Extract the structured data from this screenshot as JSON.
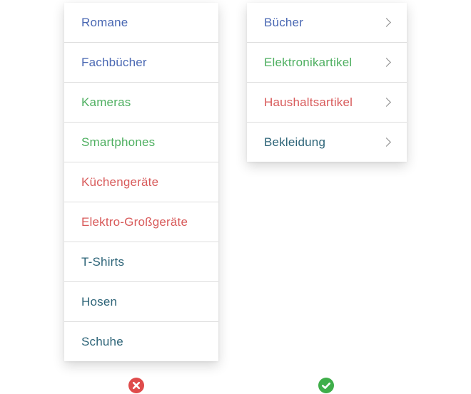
{
  "colors": {
    "books": "#4a68b3",
    "electronics": "#4eaf60",
    "household": "#d85a5a",
    "clothing": "#2d6478",
    "error": "#df4b4b",
    "success": "#3fae4a"
  },
  "flat_menu": {
    "items": [
      {
        "label": "Romane",
        "group": "books"
      },
      {
        "label": "Fachbücher",
        "group": "books"
      },
      {
        "label": "Kameras",
        "group": "electronics"
      },
      {
        "label": "Smartphones",
        "group": "electronics"
      },
      {
        "label": "Küchengeräte",
        "group": "household"
      },
      {
        "label": "Elektro-Großgeräte",
        "group": "household"
      },
      {
        "label": "T-Shirts",
        "group": "clothing"
      },
      {
        "label": "Hosen",
        "group": "clothing"
      },
      {
        "label": "Schuhe",
        "group": "clothing"
      }
    ]
  },
  "grouped_menu": {
    "items": [
      {
        "label": "Bücher",
        "group": "books"
      },
      {
        "label": "Elektronikartikel",
        "group": "electronics"
      },
      {
        "label": "Haushaltsartikel",
        "group": "household"
      },
      {
        "label": "Bekleidung",
        "group": "clothing"
      }
    ]
  },
  "icons": {
    "bad_example": "x-circle-icon",
    "good_example": "check-circle-icon"
  }
}
